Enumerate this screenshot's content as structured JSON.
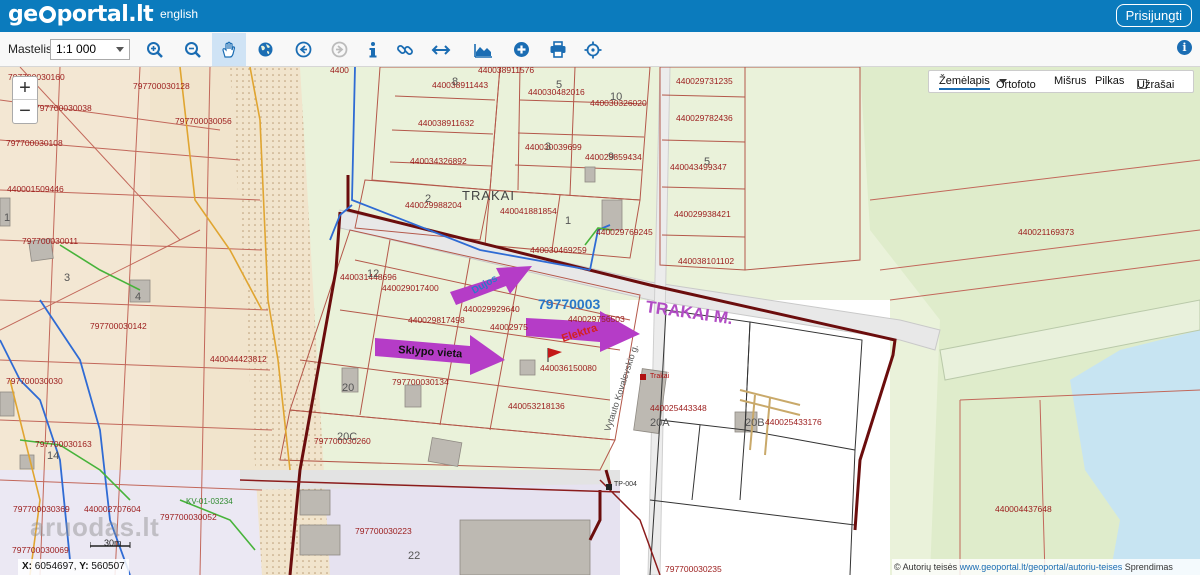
{
  "header": {
    "logo_left": "ge",
    "logo_right": "portal.lt",
    "lang_link": "english",
    "login_button": "Prisijungti"
  },
  "toolbar": {
    "scale_label": "Mastelis:",
    "scale_value": "1:1 000"
  },
  "layers": {
    "selected": "Žemėlapis",
    "ortofoto": "Ortofoto",
    "misrus": "Mišrus",
    "pilkas": "Pilkas",
    "uzrasai": "Užrašai"
  },
  "map": {
    "town_label": "TRAKAI",
    "town_label_big": "TRAKAI M.",
    "parcel_highlight": "79770003",
    "street": "Vytauto Kovalevskio g.",
    "annotations": {
      "site": "Sklypo vieta",
      "power": "Elektra",
      "water": "Dujos"
    },
    "parcel_labels": [
      {
        "id": "p01",
        "text": "4400"
      },
      {
        "id": "p02",
        "text": "440038911576"
      },
      {
        "id": "p03",
        "text": "440038911443"
      },
      {
        "id": "p04",
        "text": "440030482016"
      },
      {
        "id": "p05",
        "text": "440030326020"
      },
      {
        "id": "p06",
        "text": "440029731235"
      },
      {
        "id": "p07",
        "text": "440038911632"
      },
      {
        "id": "p08",
        "text": "440030039699"
      },
      {
        "id": "p09",
        "text": "440029782436"
      },
      {
        "id": "p10",
        "text": "440034326892"
      },
      {
        "id": "p11",
        "text": "440029859434"
      },
      {
        "id": "p12",
        "text": "440043499347"
      },
      {
        "id": "p13",
        "text": "440029988204"
      },
      {
        "id": "p14",
        "text": "440041881854"
      },
      {
        "id": "p15",
        "text": "440029938421"
      },
      {
        "id": "p16",
        "text": "440029769245"
      },
      {
        "id": "p17",
        "text": "440021169373"
      },
      {
        "id": "p18",
        "text": "440030469259"
      },
      {
        "id": "p19",
        "text": "440038101102"
      },
      {
        "id": "p20",
        "text": "440031448696"
      },
      {
        "id": "p21",
        "text": "440029017400"
      },
      {
        "id": "p22",
        "text": "440029929640"
      },
      {
        "id": "p23",
        "text": "440029817498"
      },
      {
        "id": "p24",
        "text": "44002975"
      },
      {
        "id": "p25",
        "text": "440029756503"
      },
      {
        "id": "p26",
        "text": "440036150080"
      },
      {
        "id": "p27",
        "text": "440053218136"
      },
      {
        "id": "p28",
        "text": "440025443348"
      },
      {
        "id": "p29",
        "text": "440025433176"
      },
      {
        "id": "p30",
        "text": "440004437648"
      },
      {
        "id": "p31",
        "text": "797700030160"
      },
      {
        "id": "p32",
        "text": "797700030128"
      },
      {
        "id": "p33",
        "text": "797700030038"
      },
      {
        "id": "p34",
        "text": "797700030056"
      },
      {
        "id": "p35",
        "text": "797700030108"
      },
      {
        "id": "p36",
        "text": "440001509446"
      },
      {
        "id": "p37",
        "text": "797700030011"
      },
      {
        "id": "p38",
        "text": "797700030142"
      },
      {
        "id": "p39",
        "text": "440044423812"
      },
      {
        "id": "p40",
        "text": "797700030030"
      },
      {
        "id": "p41",
        "text": "797700030134"
      },
      {
        "id": "p42",
        "text": "797700030163"
      },
      {
        "id": "p43",
        "text": "797700030260"
      },
      {
        "id": "p44",
        "text": "797700030369"
      },
      {
        "id": "p45",
        "text": "440002707604"
      },
      {
        "id": "p46",
        "text": "797700030069"
      },
      {
        "id": "p47",
        "text": "797700030223"
      },
      {
        "id": "p48",
        "text": "797700030235"
      },
      {
        "id": "p49",
        "text": "797700030052"
      }
    ],
    "house_numbers": [
      {
        "id": "h01",
        "text": "8"
      },
      {
        "id": "h02",
        "text": "5"
      },
      {
        "id": "h03",
        "text": "10"
      },
      {
        "id": "h04",
        "text": "3"
      },
      {
        "id": "h05",
        "text": "9"
      },
      {
        "id": "h06",
        "text": "5"
      },
      {
        "id": "h07",
        "text": "2"
      },
      {
        "id": "h08",
        "text": "1"
      },
      {
        "id": "h09",
        "text": "12"
      },
      {
        "id": "h10",
        "text": "1"
      },
      {
        "id": "h11",
        "text": "3"
      },
      {
        "id": "h12",
        "text": "4"
      },
      {
        "id": "h13",
        "text": "20"
      },
      {
        "id": "h14",
        "text": "20C"
      },
      {
        "id": "h15",
        "text": "14"
      },
      {
        "id": "h16",
        "text": "20A"
      },
      {
        "id": "h17",
        "text": "20B"
      },
      {
        "id": "h18",
        "text": "22"
      }
    ],
    "tp_label": "Trakai",
    "tp_label2": "TP-004",
    "kv_label": "KV-01-03234"
  },
  "status": {
    "coord_x_label": "X:",
    "coord_x": "6054697",
    "coord_y_label": "Y:",
    "coord_y": "560507",
    "scale_text": "30m",
    "watermark": "aruodas.lt"
  },
  "attribution": {
    "prefix": "© Autorių teisės",
    "link": "www.geoportal.lt/geoportal/autoriu-teises",
    "suffix": "Sprendimas"
  },
  "colors": {
    "header": "#0b7bbd",
    "parcel_line": "#b4584a",
    "parcel_text": "#9b1b1b",
    "arrow": "#b53cc7",
    "road_gray": "#cfcfcf",
    "highlight_parcel": "#2a78c8"
  }
}
